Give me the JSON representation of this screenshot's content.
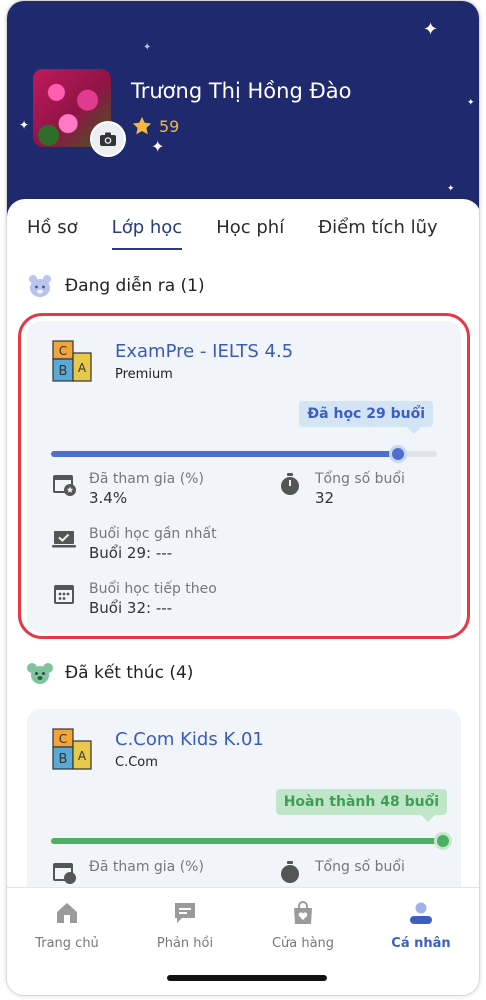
{
  "profile": {
    "name": "Trương Thị Hồng Đào",
    "points": "59"
  },
  "tabs": [
    "Hồ sơ",
    "Lớp học",
    "Học phí",
    "Điểm tích lũy"
  ],
  "active_tab": 1,
  "ongoing": {
    "title": "Đang diễn ra (1)",
    "course": {
      "name": "ExamPre - IELTS 4.5",
      "type": "Premium",
      "progress_label": "Đã học 29 buổi",
      "progress": 0.9,
      "participation_label": "Đã tham gia (%)",
      "participation_value": "3.4%",
      "total_label": "Tổng số buổi",
      "total_value": "32",
      "last_label": "Buổi học gần nhất",
      "last_value": "Buổi 29: ---",
      "next_label": "Buổi học tiếp theo",
      "next_value": "Buổi 32: ---"
    }
  },
  "finished": {
    "title": "Đã kết thúc (4)",
    "course": {
      "name": "C.Com Kids K.01",
      "type": "C.Com",
      "progress_label": "Hoàn thành 48 buổi",
      "progress": 1.0,
      "participation_label": "Đã tham gia (%)",
      "total_label": "Tổng số buổi"
    }
  },
  "nav": [
    "Trang chủ",
    "Phản hồi",
    "Cửa hàng",
    "Cá nhân"
  ],
  "colors": {
    "header": "#1f2a6e",
    "accent_blue": "#3d5fc4",
    "progress_green": "#4caf62",
    "highlight_red": "#e53945",
    "star_gold": "#f5b742"
  }
}
